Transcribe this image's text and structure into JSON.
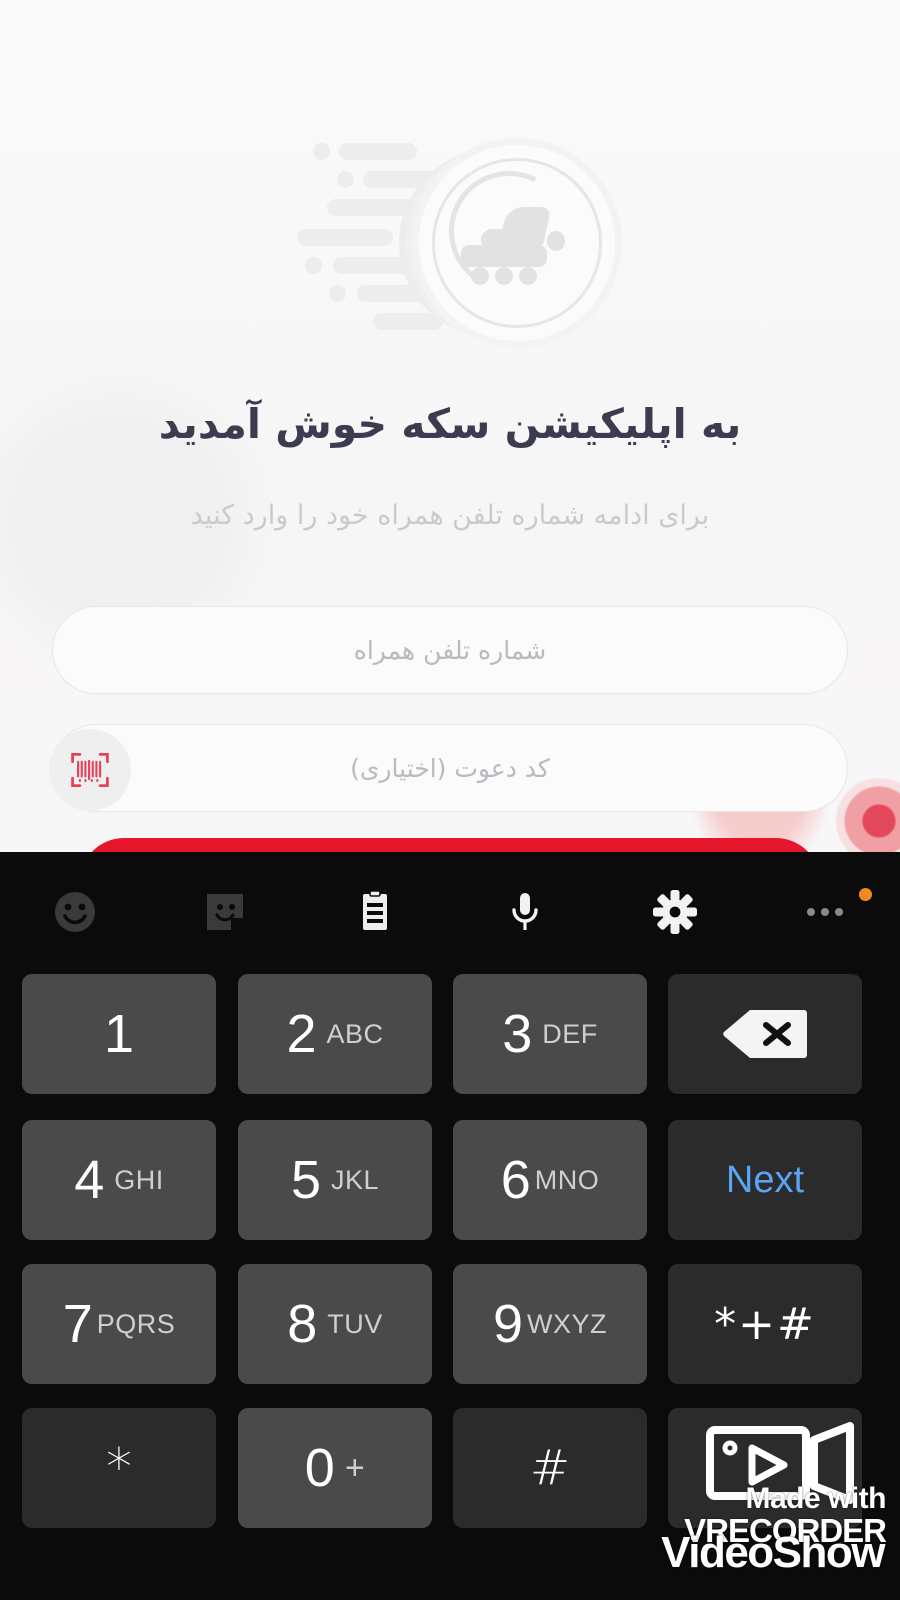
{
  "app": {
    "background_color": "#f7f6f6",
    "logo_icon": "coin-skate-logo",
    "title": "به اپلیکیشن سکه خوش آمدید",
    "subtitle": "برای ادامه شماره تلفن همراه خود را وارد کنید"
  },
  "form": {
    "phone": {
      "placeholder": "شماره تلفن همراه",
      "value": ""
    },
    "invite": {
      "placeholder": "کد دعوت (اختیاری)",
      "value": "",
      "scan_icon": "barcode-scan-icon",
      "scan_icon_color": "#e8405a"
    },
    "submit": {
      "label": "",
      "color": "#e8162c"
    }
  },
  "keyboard": {
    "background_color": "#0b0b0b",
    "key_color": "#4a4a4a",
    "function_key_color": "#2b2b2b",
    "accent_color": "#5ba3f5",
    "toolbar": [
      {
        "name": "emoji-icon",
        "label": "emoji"
      },
      {
        "name": "sticker-icon",
        "label": "sticker"
      },
      {
        "name": "clipboard-icon",
        "label": "clipboard"
      },
      {
        "name": "microphone-icon",
        "label": "voice input"
      },
      {
        "name": "gear-icon",
        "label": "settings"
      },
      {
        "name": "more-icon",
        "label": "more",
        "badge_color": "#f08a1e"
      }
    ],
    "rows": [
      [
        {
          "digit": "1",
          "letters": "",
          "name": "key-1",
          "type": "digit"
        },
        {
          "digit": "2",
          "letters": "ABC",
          "name": "key-2",
          "type": "digit"
        },
        {
          "digit": "3",
          "letters": "DEF",
          "name": "key-3",
          "type": "digit"
        },
        {
          "digit": "",
          "letters": "",
          "name": "key-backspace",
          "type": "backspace"
        }
      ],
      [
        {
          "digit": "4",
          "letters": "GHI",
          "name": "key-4",
          "type": "digit"
        },
        {
          "digit": "5",
          "letters": "JKL",
          "name": "key-5",
          "type": "digit"
        },
        {
          "digit": "6",
          "letters": "MNO",
          "name": "key-6",
          "type": "digit"
        },
        {
          "digit": "",
          "letters": "Next",
          "name": "key-next",
          "type": "next"
        }
      ],
      [
        {
          "digit": "7",
          "letters": "PQRS",
          "name": "key-7",
          "type": "digit"
        },
        {
          "digit": "8",
          "letters": "TUV",
          "name": "key-8",
          "type": "digit"
        },
        {
          "digit": "9",
          "letters": "WXYZ",
          "name": "key-9",
          "type": "digit"
        },
        {
          "digit": "",
          "letters": "*+#",
          "name": "key-symbols",
          "type": "symbols"
        }
      ],
      [
        {
          "digit": "*",
          "letters": "",
          "name": "key-star",
          "type": "star"
        },
        {
          "digit": "0",
          "letters": "+",
          "name": "key-0",
          "type": "digit"
        },
        {
          "digit": "#",
          "letters": "",
          "name": "key-hash",
          "type": "hash"
        },
        {
          "digit": "",
          "letters": "",
          "name": "key-video",
          "type": "video"
        }
      ]
    ]
  },
  "watermarks": {
    "made_with": "Made with",
    "vrecorder": "VRECORDER",
    "videoshow": "VideoShow"
  }
}
